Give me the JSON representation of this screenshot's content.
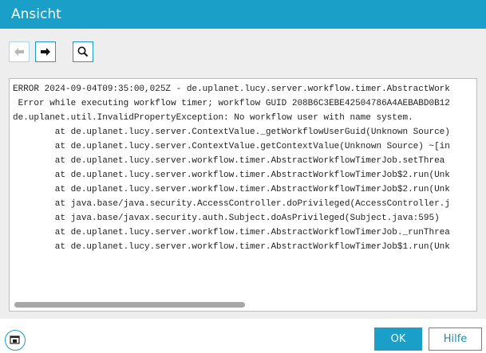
{
  "dialog": {
    "title": "Ansicht"
  },
  "toolbar": {
    "back_icon": "arrow-left-icon",
    "forward_icon": "arrow-right-icon",
    "search_icon": "search-icon"
  },
  "log": {
    "lines": [
      "ERROR 2024-09-04T09:35:00,025Z - de.uplanet.lucy.server.workflow.timer.AbstractWork",
      " Error while executing workflow timer; workflow GUID 208B6C3EBE42504786A4AEBABD0B12",
      "de.uplanet.util.InvalidPropertyException: No workflow user with name system.",
      "        at de.uplanet.lucy.server.ContextValue._getWorkflowUserGuid(Unknown Source)",
      "        at de.uplanet.lucy.server.ContextValue.getContextValue(Unknown Source) ~[in",
      "        at de.uplanet.lucy.server.workflow.timer.AbstractWorkflowTimerJob.setThrea",
      "        at de.uplanet.lucy.server.workflow.timer.AbstractWorkflowTimerJob$2.run(Unk",
      "        at de.uplanet.lucy.server.workflow.timer.AbstractWorkflowTimerJob$2.run(Unk",
      "        at java.base/java.security.AccessController.doPrivileged(AccessController.j",
      "        at java.base/javax.security.auth.Subject.doAsPrivileged(Subject.java:595)",
      "        at de.uplanet.lucy.server.workflow.timer.AbstractWorkflowTimerJob._runThrea",
      "        at de.uplanet.lucy.server.workflow.timer.AbstractWorkflowTimerJob$1.run(Unk"
    ]
  },
  "footer": {
    "window_icon": "restore-window-icon",
    "ok_label": "OK",
    "help_label": "Hilfe"
  },
  "colors": {
    "accent": "#1aa0c8",
    "content_bg": "#eeeeee",
    "panel_border": "#bdbdbd"
  }
}
